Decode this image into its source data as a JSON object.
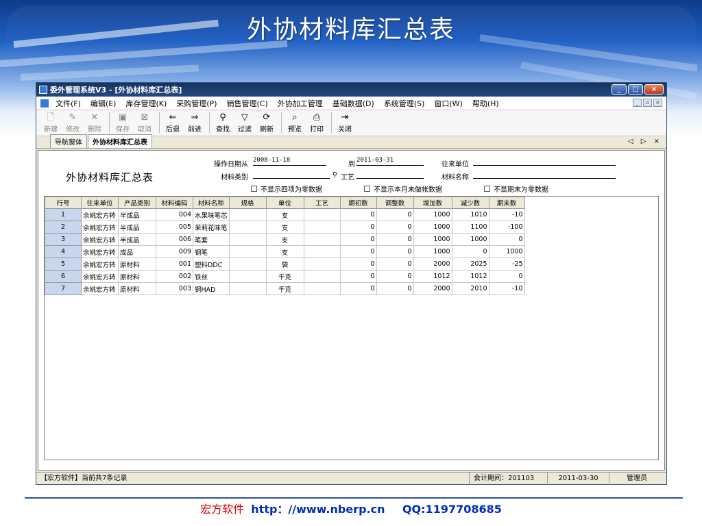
{
  "slide": {
    "title": "外协材料库汇总表"
  },
  "window": {
    "title": "委外管理系统V3 - [外协材料库汇总表]",
    "buttons": {
      "minimize": "_",
      "maximize": "□",
      "close": "×"
    }
  },
  "menu": {
    "items": [
      "文件(F)",
      "编辑(E)",
      "库存管理(K)",
      "采购管理(P)",
      "销售管理(C)",
      "外协加工管理",
      "基础数据(D)",
      "系统管理(S)",
      "窗口(W)",
      "帮助(H)"
    ],
    "mdi": [
      "_",
      "▫",
      "×"
    ]
  },
  "toolbar": {
    "new": "新建",
    "edit": "修改",
    "delete": "删除",
    "save": "保存",
    "cancel": "取消",
    "back": "后退",
    "forward": "前进",
    "find": "查找",
    "filter": "过滤",
    "refresh": "刷新",
    "preview": "预览",
    "print": "打印",
    "close": "关闭"
  },
  "tabs": {
    "nav": "导航窗体",
    "active": "外协材料库汇总表",
    "controls": "◁ ▷ ×"
  },
  "report": {
    "title": "外协材料库汇总表",
    "date_from_label": "操作日期从",
    "date_from": "2008-11-18",
    "date_to_label": "到",
    "date_to": "2011-03-31",
    "partner_label": "往来单位",
    "partner_value": "",
    "category_label": "材料类别",
    "category_value": "",
    "process_label": "工艺",
    "process_value": "",
    "material_label": "材料名称",
    "material_value": "",
    "check1": "不显示四项为零数据",
    "check2": "不显示本月未做帐数据",
    "check3": "不显期末为零数据"
  },
  "table": {
    "columns": [
      "行号",
      "往来单位",
      "产品类别",
      "材料编码",
      "材料名称",
      "规格",
      "单位",
      "工艺",
      "期初数",
      "调整数",
      "增加数",
      "减少数",
      "期末数"
    ],
    "rows": [
      {
        "no": "1",
        "partner": "余姚宏方转",
        "category": "半成品",
        "code": "004",
        "name": "水果味笔芯",
        "spec": "",
        "unit": "支",
        "process": "",
        "opening": "0",
        "adjust": "0",
        "increase": "1000",
        "decrease": "1010",
        "closing": "-10"
      },
      {
        "no": "2",
        "partner": "余姚宏方转",
        "category": "半成品",
        "code": "005",
        "name": "茉莉花味笔",
        "spec": "",
        "unit": "支",
        "process": "",
        "opening": "0",
        "adjust": "0",
        "increase": "1000",
        "decrease": "1100",
        "closing": "-100"
      },
      {
        "no": "3",
        "partner": "余姚宏方转",
        "category": "半成品",
        "code": "006",
        "name": "笔套",
        "spec": "",
        "unit": "支",
        "process": "",
        "opening": "0",
        "adjust": "0",
        "increase": "1000",
        "decrease": "1000",
        "closing": "0"
      },
      {
        "no": "4",
        "partner": "余姚宏方转",
        "category": "成品",
        "code": "009",
        "name": "钢笔",
        "spec": "",
        "unit": "支",
        "process": "",
        "opening": "0",
        "adjust": "0",
        "increase": "1000",
        "decrease": "0",
        "closing": "1000"
      },
      {
        "no": "5",
        "partner": "余姚宏方转",
        "category": "原材料",
        "code": "001",
        "name": "塑料DDC",
        "spec": "",
        "unit": "袋",
        "process": "",
        "opening": "0",
        "adjust": "0",
        "increase": "2000",
        "decrease": "2025",
        "closing": "-25"
      },
      {
        "no": "6",
        "partner": "余姚宏方转",
        "category": "原材料",
        "code": "002",
        "name": "铁丝",
        "spec": "",
        "unit": "千克",
        "process": "",
        "opening": "0",
        "adjust": "0",
        "increase": "1012",
        "decrease": "1012",
        "closing": "0"
      },
      {
        "no": "7",
        "partner": "余姚宏方转",
        "category": "原材料",
        "code": "003",
        "name": "铜HAD",
        "spec": "",
        "unit": "千克",
        "process": "",
        "opening": "0",
        "adjust": "0",
        "increase": "2000",
        "decrease": "2010",
        "closing": "-10"
      }
    ]
  },
  "status": {
    "message": "【宏方软件】当前共7条记录",
    "period": "会计期间：201103",
    "date": "2011-03-30",
    "user": "管理员"
  },
  "footer": {
    "brand": "宏方软件",
    "url": "http：//www.nberp.cn",
    "qq": "QQ:1197708685"
  },
  "colors": {
    "banner": "#1f5fc4",
    "titlebar": "#16335f",
    "footer_brand": "#d40000",
    "footer_link": "#002bb8",
    "rownum_bg": "#c9d6ee"
  }
}
